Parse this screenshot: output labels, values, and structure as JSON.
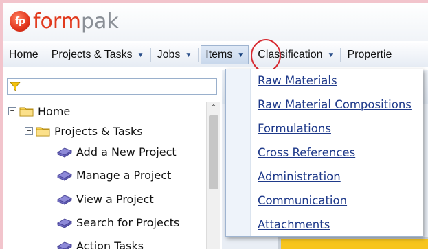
{
  "logo": {
    "mark": "fp",
    "word_form": "form",
    "word_pak": "pak"
  },
  "menubar": {
    "items": [
      {
        "label": "Home",
        "has_caret": false
      },
      {
        "label": "Projects & Tasks",
        "has_caret": true
      },
      {
        "label": "Jobs",
        "has_caret": true
      },
      {
        "label": "Items",
        "has_caret": true,
        "active": true
      },
      {
        "label": "Classification",
        "has_caret": true
      },
      {
        "label": "Propertie",
        "has_caret": false
      }
    ],
    "caret_glyph": "▼"
  },
  "dropdown": {
    "items": [
      "Raw Materials",
      "Raw Material Compositions",
      "Formulations",
      "Cross References",
      "Administration",
      "Communication",
      "Attachments"
    ]
  },
  "tree": {
    "items": [
      {
        "label": "Home",
        "expander": "−",
        "type": "folder"
      },
      {
        "label": "Projects & Tasks",
        "expander": "−",
        "type": "folder"
      },
      {
        "label": "Add a New Project",
        "type": "leaf"
      },
      {
        "label": "Manage a Project",
        "type": "leaf"
      },
      {
        "label": "View a Project",
        "type": "leaf"
      },
      {
        "label": "Search for Projects",
        "type": "leaf"
      },
      {
        "label": "Action Tasks",
        "type": "leaf"
      }
    ]
  },
  "scrollbar": {
    "up_glyph": "⌃"
  },
  "colors": {
    "brand_red": "#e13a1e",
    "brand_gray": "#8a8f96",
    "link_blue": "#1f3a8a",
    "highlight_circle": "#d7282f",
    "frame_border": "#f2c4cc"
  }
}
